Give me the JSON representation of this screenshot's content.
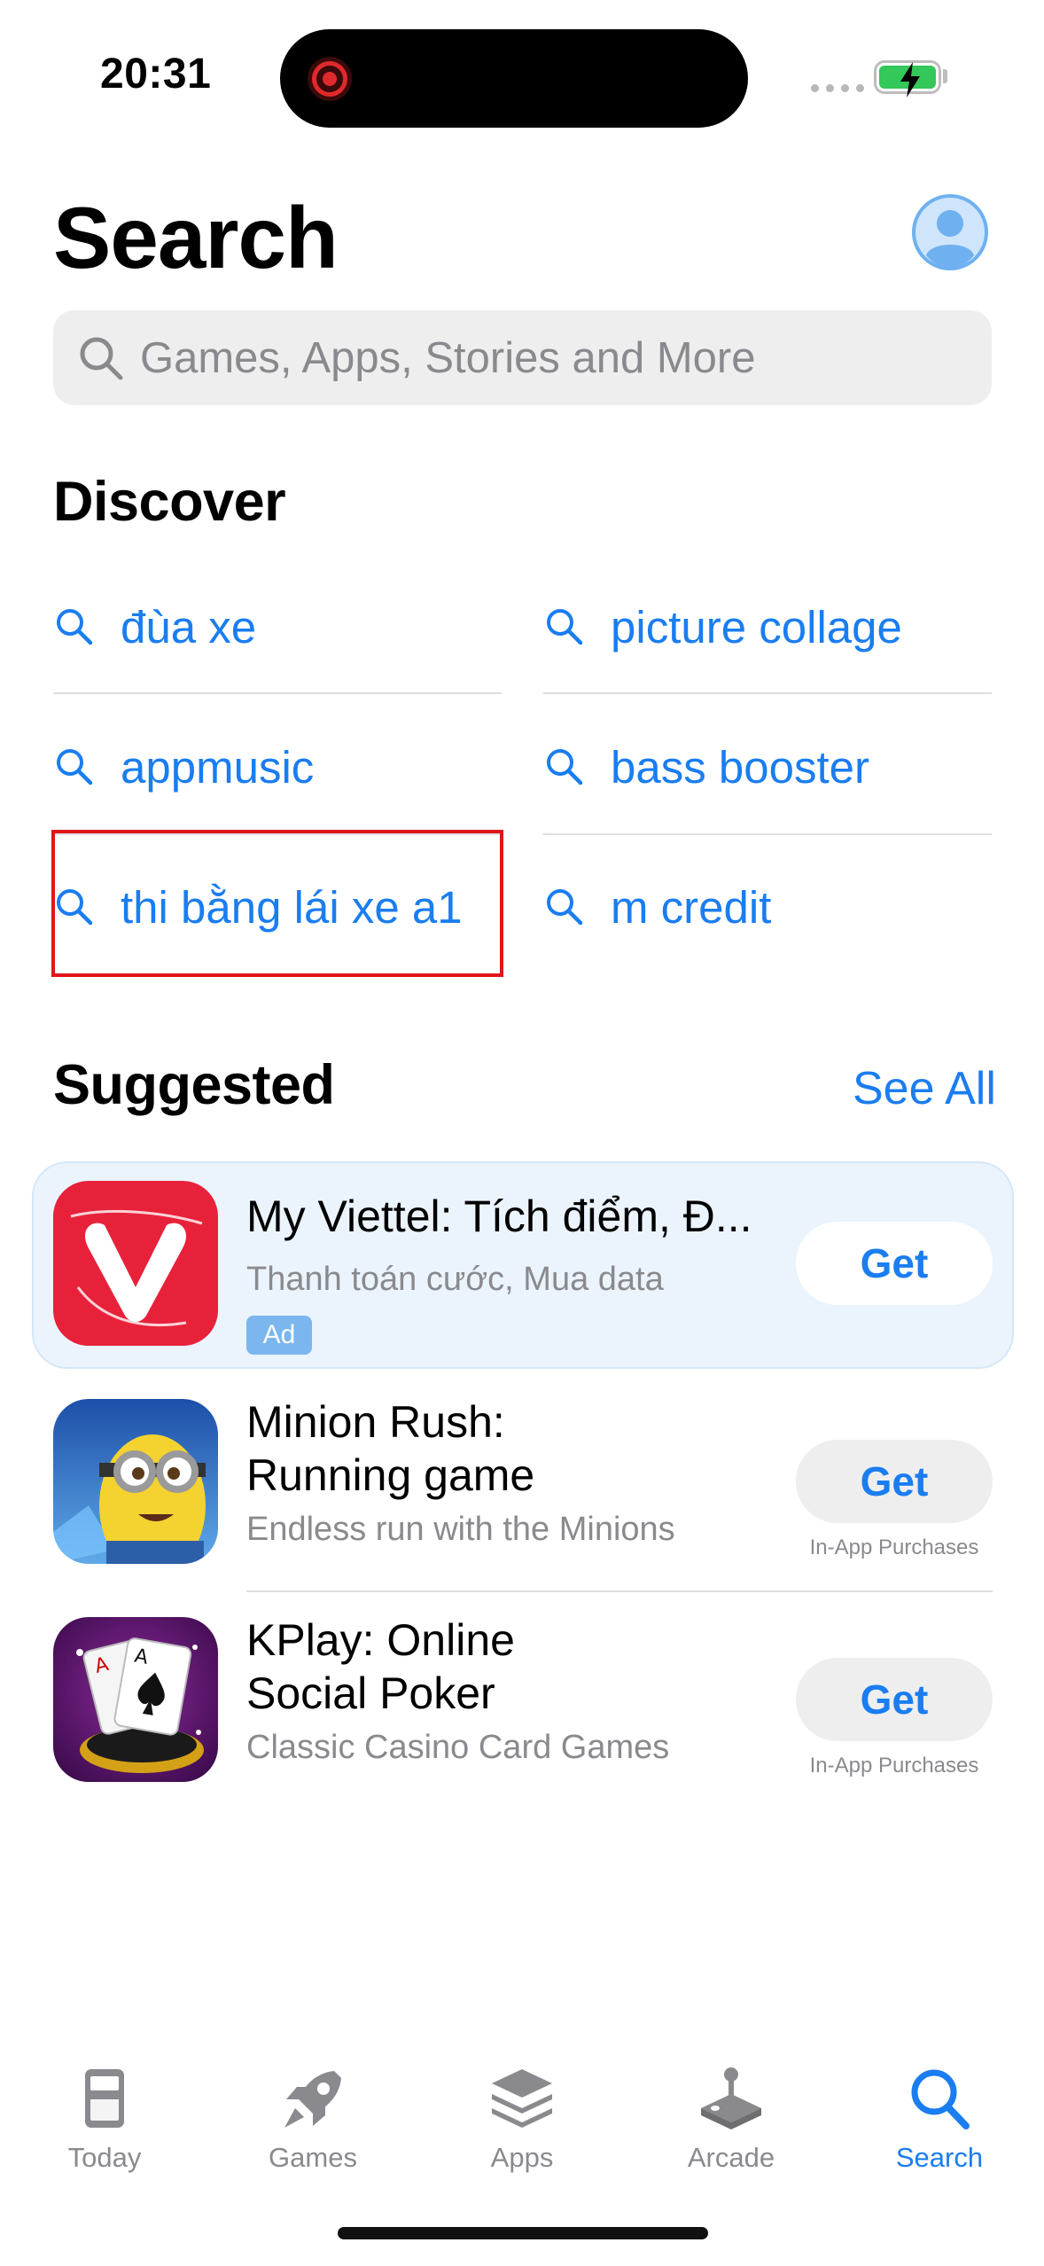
{
  "status_bar": {
    "time": "20:31"
  },
  "header": {
    "title": "Search"
  },
  "search": {
    "placeholder": "Games, Apps, Stories and More"
  },
  "discover": {
    "title": "Discover",
    "items": [
      {
        "label": "đùa xe"
      },
      {
        "label": "picture collage"
      },
      {
        "label": "appmusic"
      },
      {
        "label": "bass booster"
      },
      {
        "label": "thi bằng lái xe a1"
      },
      {
        "label": "m credit"
      }
    ]
  },
  "suggested": {
    "title": "Suggested",
    "see_all": "See All",
    "apps": [
      {
        "name": "My Viettel: Tích điểm, Đ...",
        "subtitle": "Thanh toán cước, Mua data",
        "badge": "Ad",
        "button": "Get"
      },
      {
        "name_line1": "Minion Rush:",
        "name_line2": "Running game",
        "subtitle": "Endless run with the Minions",
        "button": "Get",
        "note": "In-App Purchases"
      },
      {
        "name_line1": "KPlay: Online",
        "name_line2": "Social Poker",
        "subtitle": "Classic Casino Card Games",
        "button": "Get",
        "note": "In-App Purchases"
      }
    ]
  },
  "tabs": [
    {
      "label": "Today",
      "icon": "today-icon"
    },
    {
      "label": "Games",
      "icon": "rocket-icon"
    },
    {
      "label": "Apps",
      "icon": "apps-stack-icon"
    },
    {
      "label": "Arcade",
      "icon": "joystick-icon"
    },
    {
      "label": "Search",
      "icon": "search-icon",
      "active": true
    }
  ],
  "colors": {
    "accent": "#1a7df0",
    "highlight_border": "#e0161a",
    "ad_background": "#ebf4fd"
  }
}
